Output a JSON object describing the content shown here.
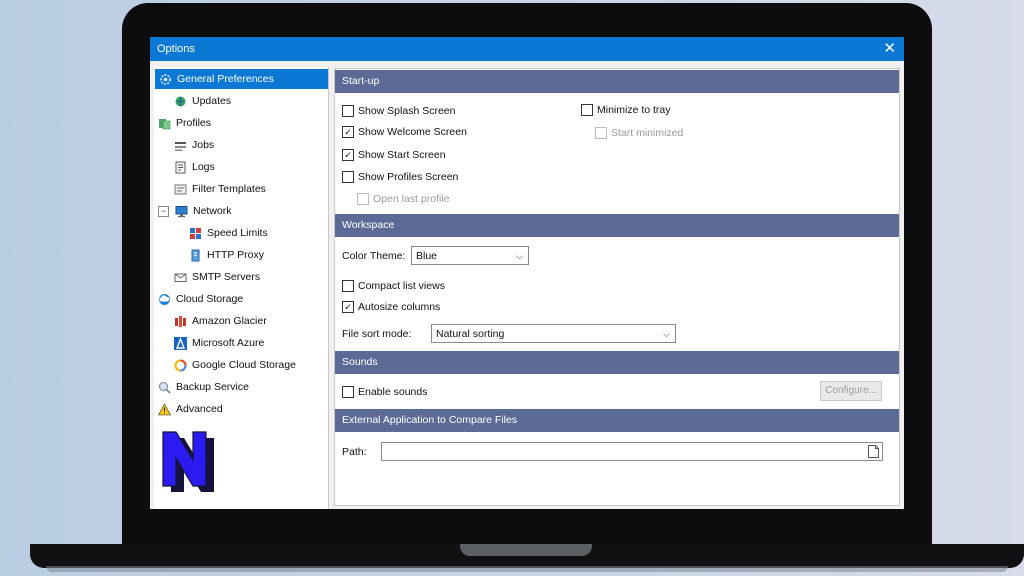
{
  "window": {
    "title": "Options"
  },
  "sidebar": {
    "items": [
      {
        "label": "General Preferences",
        "icon": "gear-icon",
        "selected": true
      },
      {
        "label": "Updates",
        "icon": "globe-update-icon"
      },
      {
        "label": "Profiles",
        "icon": "profiles-icon"
      },
      {
        "label": "Jobs",
        "icon": "jobs-icon"
      },
      {
        "label": "Logs",
        "icon": "logs-icon"
      },
      {
        "label": "Filter Templates",
        "icon": "filter-icon"
      },
      {
        "label": "Network",
        "icon": "network-icon",
        "expander": "−"
      },
      {
        "label": "Speed Limits",
        "icon": "speed-icon"
      },
      {
        "label": "HTTP Proxy",
        "icon": "proxy-icon"
      },
      {
        "label": "SMTP Servers",
        "icon": "mail-icon"
      },
      {
        "label": "Cloud Storage",
        "icon": "cloud-icon"
      },
      {
        "label": "Amazon Glacier",
        "icon": "amazon-glacier-icon"
      },
      {
        "label": "Microsoft Azure",
        "icon": "azure-icon"
      },
      {
        "label": "Google Cloud Storage",
        "icon": "google-cloud-icon"
      },
      {
        "label": "Backup Service",
        "icon": "backup-service-icon"
      },
      {
        "label": "Advanced",
        "icon": "warning-icon"
      }
    ],
    "logo_letter": "N"
  },
  "startup": {
    "header": "Start-up",
    "show_splash": {
      "label": "Show Splash Screen",
      "checked": false
    },
    "show_welcome": {
      "label": "Show Welcome Screen",
      "checked": true
    },
    "show_start": {
      "label": "Show Start Screen",
      "checked": true
    },
    "show_profiles": {
      "label": "Show Profiles Screen",
      "checked": false
    },
    "open_last_profile": {
      "label": "Open last profile",
      "checked": false,
      "disabled": true
    },
    "minimize_to_tray": {
      "label": "Minimize to tray",
      "checked": false
    },
    "start_minimized": {
      "label": "Start minimized",
      "checked": false,
      "disabled": true
    }
  },
  "workspace": {
    "header": "Workspace",
    "color_theme_label": "Color Theme:",
    "color_theme_value": "Blue",
    "compact_list": {
      "label": "Compact list views",
      "checked": false
    },
    "autosize": {
      "label": "Autosize columns",
      "checked": true
    },
    "sort_label": "File sort mode:",
    "sort_value": "Natural sorting"
  },
  "sounds": {
    "header": "Sounds",
    "enable": {
      "label": "Enable sounds",
      "checked": false
    },
    "configure_label": "Configure..."
  },
  "compare": {
    "header": "External Application to Compare Files",
    "path_label": "Path:",
    "path_value": ""
  },
  "colors": {
    "titlebar": "#0a78d4",
    "section_header": "#5b6b96",
    "selection": "#0a78d4",
    "logo": "#2b1bf0"
  }
}
